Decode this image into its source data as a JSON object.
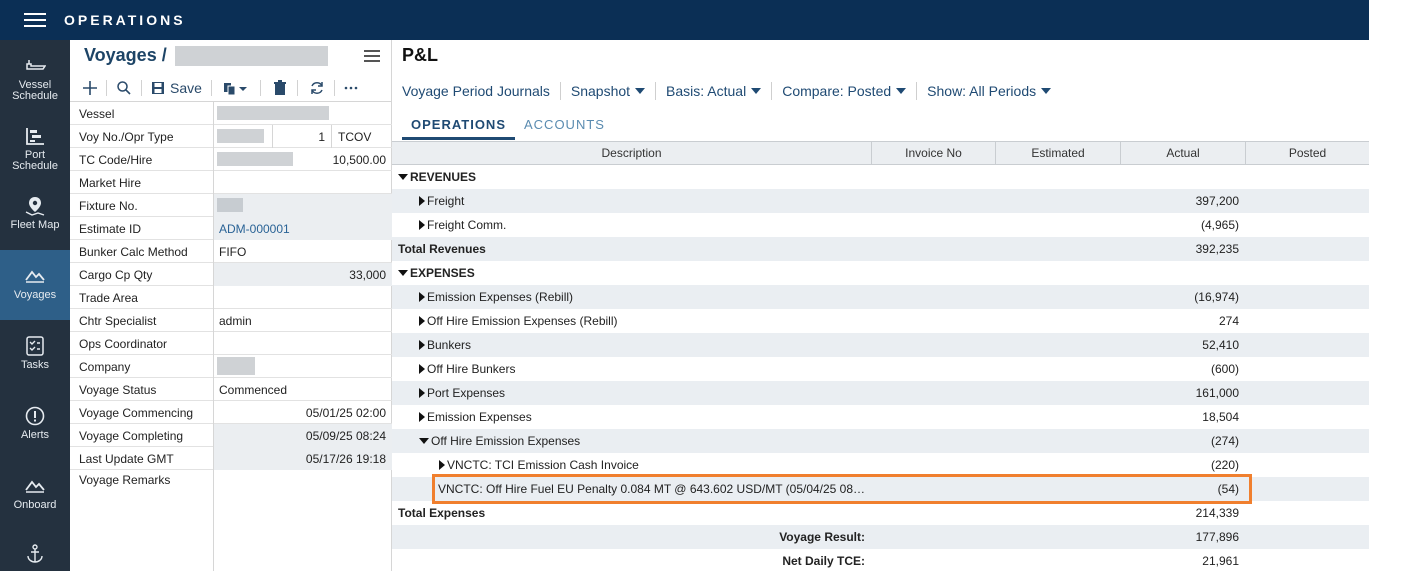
{
  "topbar": {
    "title": "OPERATIONS",
    "menu_icon": "hamburger-icon"
  },
  "nav": [
    {
      "label": "Vessel Schedule",
      "line1": "Vessel",
      "line2": "Schedule",
      "icon": "ship-icon"
    },
    {
      "label": "Port Schedule",
      "line1": "Port",
      "line2": "Schedule",
      "icon": "gantt-icon"
    },
    {
      "label": "Fleet Map",
      "line1": "Fleet Map",
      "line2": "",
      "icon": "map-pin-icon"
    },
    {
      "label": "Voyages",
      "line1": "Voyages",
      "line2": "",
      "icon": "voyage-icon",
      "active": true
    },
    {
      "label": "Tasks",
      "line1": "Tasks",
      "line2": "",
      "icon": "checklist-icon"
    },
    {
      "label": "Alerts",
      "line1": "Alerts",
      "line2": "",
      "icon": "alert-icon"
    },
    {
      "label": "Onboard",
      "line1": "Onboard",
      "line2": "",
      "icon": "onboard-icon"
    }
  ],
  "form": {
    "title": "Voyages /",
    "toolbar": {
      "save_label": "Save"
    },
    "fields": {
      "vessel": "Vessel",
      "voy_no": "Voy No./Opr Type",
      "voy_no_value": "1",
      "opr_type_value": "TCOV",
      "tc_code": "TC Code/Hire",
      "tc_hire_value": "10,500.00",
      "market_hire": "Market Hire",
      "fixture_no": "Fixture No.",
      "estimate_id": "Estimate ID",
      "estimate_id_value": "ADM-000001",
      "bunker_calc": "Bunker Calc Method",
      "bunker_calc_value": "FIFO",
      "cargo_cp_qty": "Cargo Cp Qty",
      "cargo_cp_qty_value": "33,000",
      "trade_area": "Trade Area",
      "chtr_specialist": "Chtr Specialist",
      "chtr_specialist_value": "admin",
      "ops_coordinator": "Ops Coordinator",
      "company": "Company",
      "voyage_status": "Voyage Status",
      "voyage_status_value": "Commenced",
      "voyage_commencing": "Voyage Commencing",
      "voyage_commencing_value": "05/01/25 02:00",
      "voyage_completing": "Voyage Completing",
      "voyage_completing_value": "05/09/25 08:24",
      "last_update": "Last Update GMT",
      "last_update_value": "05/17/26 19:18",
      "voyage_remarks": "Voyage Remarks"
    }
  },
  "pl": {
    "title": "P&L",
    "toolbar": {
      "journals": "Voyage Period Journals",
      "snapshot": "Snapshot",
      "basis": "Basis: Actual",
      "compare": "Compare: Posted",
      "show": "Show: All Periods"
    },
    "tabs": {
      "operations": "OPERATIONS",
      "accounts": "ACCOUNTS"
    },
    "columns": {
      "description": "Description",
      "invoice_no": "Invoice No",
      "estimated": "Estimated",
      "actual": "Actual",
      "posted": "Posted"
    },
    "rows": {
      "revenues": "REVENUES",
      "freight": "Freight",
      "freight_actual": "397,200",
      "freight_comm": "Freight Comm.",
      "freight_comm_actual": "(4,965)",
      "total_revenues": "Total Revenues",
      "total_revenues_actual": "392,235",
      "expenses": "EXPENSES",
      "emission_rebill": "Emission Expenses (Rebill)",
      "emission_rebill_actual": "(16,974)",
      "offhire_emission_rebill": "Off Hire Emission Expenses (Rebill)",
      "offhire_emission_rebill_actual": "274",
      "bunkers": "Bunkers",
      "bunkers_actual": "52,410",
      "offhire_bunkers": "Off Hire Bunkers",
      "offhire_bunkers_actual": "(600)",
      "port_expenses": "Port Expenses",
      "port_expenses_actual": "161,000",
      "emission_expenses": "Emission Expenses",
      "emission_expenses_actual": "18,504",
      "offhire_emission": "Off Hire Emission Expenses",
      "offhire_emission_actual": "(274)",
      "vnctc_tci": "VNCTC: TCI Emission Cash Invoice",
      "vnctc_tci_actual": "(220)",
      "vnctc_penalty": "VNCTC: Off Hire Fuel EU Penalty 0.084 MT @ 643.602 USD/MT (05/04/25 08…",
      "vnctc_penalty_actual": "(54)",
      "total_expenses": "Total Expenses",
      "total_expenses_actual": "214,339",
      "voyage_result": "Voyage Result:",
      "voyage_result_actual": "177,896",
      "net_daily_tce": "Net Daily TCE:",
      "net_daily_tce_actual": "21,961"
    }
  },
  "colors": {
    "topbar": "#0b2f55",
    "leftnav": "#24313f",
    "nav_active": "#2e5f88",
    "highlight": "#f07f2e"
  }
}
